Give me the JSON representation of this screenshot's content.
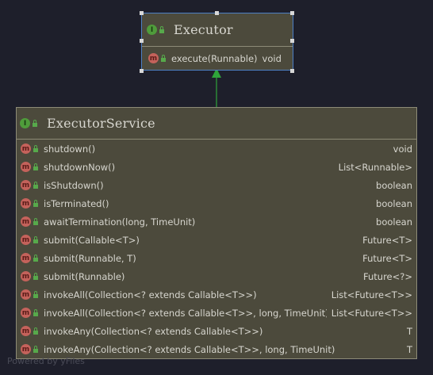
{
  "colors": {
    "background": "#1e1f2b",
    "node_fill": "#4c4a3c",
    "node_border": "#8d8b77",
    "selection_border": "#4d7fc4",
    "edge": "#2fa43a",
    "interface_badge": "#4f9c3b",
    "method_badge": "#c4625b"
  },
  "executor": {
    "badge": "I",
    "badge_icon": "interface-icon",
    "title": "Executor",
    "methods": [
      {
        "badge": "m",
        "name": "execute(Runnable)",
        "return_type": "void"
      }
    ]
  },
  "executor_service": {
    "badge": "I",
    "badge_icon": "interface-icon",
    "title": "ExecutorService",
    "methods": [
      {
        "badge": "m",
        "name": "shutdown()",
        "return_type": "void"
      },
      {
        "badge": "m",
        "name": "shutdownNow()",
        "return_type": "List<Runnable>"
      },
      {
        "badge": "m",
        "name": "isShutdown()",
        "return_type": "boolean"
      },
      {
        "badge": "m",
        "name": "isTerminated()",
        "return_type": "boolean"
      },
      {
        "badge": "m",
        "name": "awaitTermination(long, TimeUnit)",
        "return_type": "boolean"
      },
      {
        "badge": "m",
        "name": "submit(Callable<T>)",
        "return_type": "Future<T>"
      },
      {
        "badge": "m",
        "name": "submit(Runnable, T)",
        "return_type": "Future<T>"
      },
      {
        "badge": "m",
        "name": "submit(Runnable)",
        "return_type": "Future<?>"
      },
      {
        "badge": "m",
        "name": "invokeAll(Collection<? extends Callable<T>>)",
        "return_type": "List<Future<T>>"
      },
      {
        "badge": "m",
        "name": "invokeAll(Collection<? extends Callable<T>>, long, TimeUnit)",
        "return_type": "List<Future<T>>"
      },
      {
        "badge": "m",
        "name": "invokeAny(Collection<? extends Callable<T>>)",
        "return_type": "T"
      },
      {
        "badge": "m",
        "name": "invokeAny(Collection<? extends Callable<T>>, long, TimeUnit)",
        "return_type": "T"
      }
    ]
  },
  "edge": {
    "type": "inheritance",
    "from": "ExecutorService",
    "to": "Executor"
  },
  "watermark": "Powered by yFiles"
}
